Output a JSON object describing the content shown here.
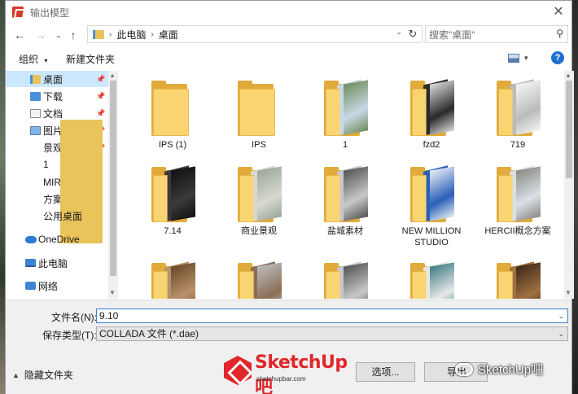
{
  "window": {
    "title": "输出模型"
  },
  "address": {
    "crumbs": [
      "此电脑",
      "桌面"
    ]
  },
  "search": {
    "placeholder": "搜索\"桌面\""
  },
  "toolbar": {
    "organize_label": "组织",
    "new_folder_label": "新建文件夹",
    "help": "?"
  },
  "sidebar": {
    "items": [
      {
        "label": "桌面",
        "icon": "desktop-folder-icon",
        "pinned": true,
        "selected": true
      },
      {
        "label": "下载",
        "icon": "download-icon",
        "pinned": true
      },
      {
        "label": "文档",
        "icon": "document-icon",
        "pinned": true
      },
      {
        "label": "图片",
        "icon": "picture-icon",
        "pinned": true
      },
      {
        "label": "景观6",
        "icon": "folder-icon",
        "pinned": true
      },
      {
        "label": "1",
        "icon": "folder-icon"
      },
      {
        "label": "MIR-1247张",
        "icon": "folder-icon"
      },
      {
        "label": "方案二",
        "icon": "folder-icon"
      },
      {
        "label": "公用桌面",
        "icon": "folder-icon"
      }
    ],
    "roots": [
      {
        "label": "OneDrive",
        "icon": "onedrive-cloud-icon"
      },
      {
        "label": "此电脑",
        "icon": "this-pc-icon"
      },
      {
        "label": "网络",
        "icon": "network-icon"
      }
    ]
  },
  "files": [
    {
      "label": "IPS (1)",
      "thumb": "empty"
    },
    {
      "label": "IPS",
      "thumb": "empty"
    },
    {
      "label": "1",
      "thumb": "photo-green"
    },
    {
      "label": "fzd2",
      "thumb": "laptop"
    },
    {
      "label": "719",
      "thumb": "grid"
    },
    {
      "label": "7.14",
      "thumb": "dark"
    },
    {
      "label": "商业景观",
      "thumb": "photo-grey"
    },
    {
      "label": "盐城素材",
      "thumb": "photo-bw"
    },
    {
      "label": "NEW  MILLION STUDIO",
      "thumb": "blue-doc"
    },
    {
      "label": "HERCII概念方案",
      "thumb": "interior"
    },
    {
      "label": "",
      "thumb": "brown"
    },
    {
      "label": "",
      "thumb": "metal"
    },
    {
      "label": "",
      "thumb": "photo-bw"
    },
    {
      "label": "",
      "thumb": "teal"
    },
    {
      "label": "",
      "thumb": "dark-brown"
    }
  ],
  "form": {
    "filename_label": "文件名(N):",
    "filename_value": "9.10",
    "filetype_label": "保存类型(T):",
    "filetype_value": "COLLADA 文件 (*.dae)"
  },
  "footer": {
    "hide_folders_label": "隐藏文件夹",
    "options_label": "选项...",
    "export_label": "导出"
  },
  "watermark": {
    "logo_text": "SketchUp吧",
    "logo_url": "sketchupbar.com",
    "wechat_text": "SketchUp吧"
  }
}
